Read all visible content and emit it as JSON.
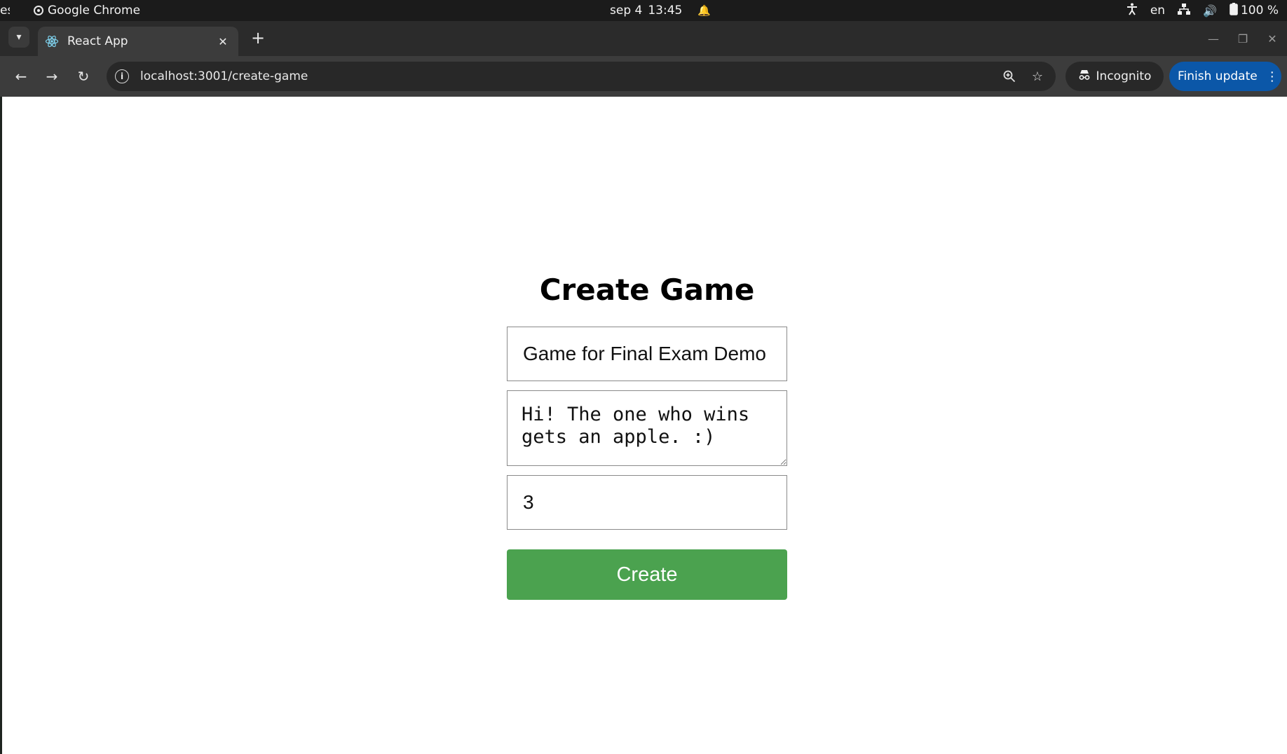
{
  "os_bar": {
    "activities": "es",
    "app_name": "Google Chrome",
    "date": "sep 4",
    "time": "13:45",
    "language": "en",
    "battery": "100 %"
  },
  "browser": {
    "tab_title": "React App",
    "url": "localhost:3001/create-game",
    "incognito_label": "Incognito",
    "finish_update_label": "Finish update"
  },
  "page": {
    "title": "Create Game",
    "game_name_value": "Game for Final Exam Demo",
    "description_value": "Hi! The one who wins gets an apple. :)",
    "number_value": "3",
    "create_label": "Create",
    "accent_color": "#4ba24f"
  }
}
